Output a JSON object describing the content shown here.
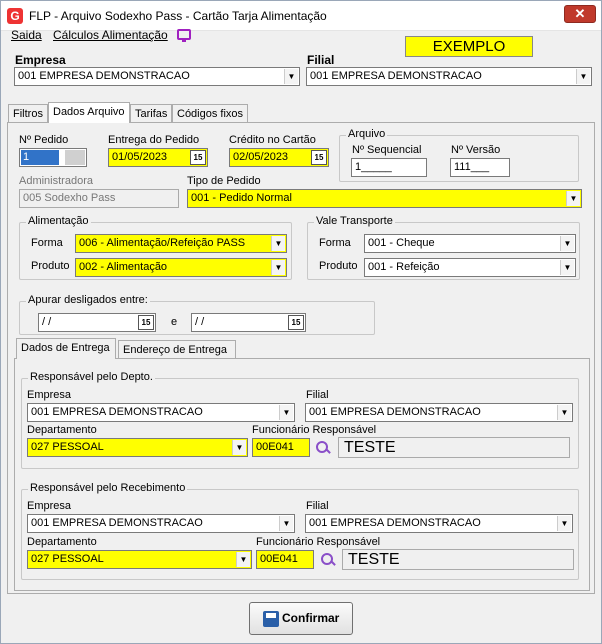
{
  "window": {
    "title": "FLP - Arquivo Sodexho Pass - Cartão Tarja Alimentação",
    "app_icon": "G",
    "close_glyph": "✕"
  },
  "menu": {
    "items": [
      "Saida",
      "Cálculos Alimentação"
    ]
  },
  "badge": "EXEMPLO",
  "top": {
    "empresa_label": "Empresa",
    "empresa_value": "001 EMPRESA DEMONSTRACAO",
    "filial_label": "Filial",
    "filial_value": "001 EMPRESA DEMONSTRACAO"
  },
  "tabs": [
    "Filtros",
    "Dados Arquivo",
    "Tarifas",
    "Códigos fixos"
  ],
  "active_tab": "Dados Arquivo",
  "dados": {
    "pedido_label": "Nº Pedido",
    "pedido_value": "1",
    "entrega_label": "Entrega do Pedido",
    "entrega_value": "01/05/2023",
    "credito_label": "Crédito no Cartão",
    "credito_value": "02/05/2023",
    "arquivo_group": "Arquivo",
    "sequencial_label": "Nº Sequencial",
    "sequencial_value": "1_____",
    "versao_label": "Nº Versão",
    "versao_value": "111___",
    "administradora_label": "Administradora",
    "administradora_value": "005 Sodexho Pass",
    "tipo_label": "Tipo de Pedido",
    "tipo_value": "001 - Pedido Normal",
    "calendar_glyph": "15"
  },
  "alimentacao": {
    "group": "Alimentação",
    "forma_label": "Forma",
    "forma_value": "006 - Alimentação/Refeição PASS",
    "produto_label": "Produto",
    "produto_value": "002 - Alimentação"
  },
  "vale": {
    "group": "Vale Transporte",
    "forma_label": "Forma",
    "forma_value": "001 - Cheque",
    "produto_label": "Produto",
    "produto_value": "001 - Refeição"
  },
  "desligados": {
    "group": "Apurar desligados entre:",
    "date1": " / /",
    "conj": "e",
    "date2": " / /"
  },
  "subtabs": [
    "Dados de Entrega",
    "Endereço de Entrega"
  ],
  "depto": {
    "group": "Responsável pelo Depto.",
    "empresa_label": "Empresa",
    "empresa_value": "001 EMPRESA DEMONSTRACAO",
    "filial_label": "Filial",
    "filial_value": "001 EMPRESA DEMONSTRACAO",
    "departamento_label": "Departamento",
    "departamento_value": "027 PESSOAL",
    "funcionario_label": "Funcionário Responsável",
    "funcionario_code": "00E041",
    "funcionario_name": "TESTE"
  },
  "recebimento": {
    "group": "Responsável pelo Recebimento",
    "empresa_label": "Empresa",
    "empresa_value": "001 EMPRESA DEMONSTRACAO",
    "filial_label": "Filial",
    "filial_value": "001 EMPRESA DEMONSTRACAO",
    "departamento_label": "Departamento",
    "departamento_value": "027 PESSOAL",
    "funcionario_label": "Funcionário Responsável",
    "funcionario_code": "00E041",
    "funcionario_name": "TESTE"
  },
  "confirm_label": "Confirmar",
  "icons": {
    "dropdown": "chevron-down-icon",
    "calendar": "calendar-icon",
    "search": "search-icon",
    "save": "save-icon",
    "tv": "tv-icon"
  }
}
